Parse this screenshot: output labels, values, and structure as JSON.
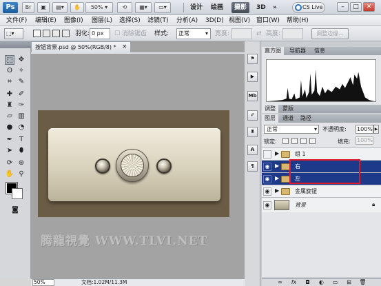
{
  "app": {
    "logo": "Ps",
    "zoom_value": "50%",
    "workspaces": [
      "设计",
      "绘画",
      "摄影",
      "3D"
    ],
    "more_label": "»",
    "cs_live": "CS Live",
    "window_controls": [
      "–",
      "□",
      "✕"
    ]
  },
  "menu": [
    "文件(F)",
    "编辑(E)",
    "图像(I)",
    "图层(L)",
    "选择(S)",
    "滤镜(T)",
    "分析(A)",
    "3D(D)",
    "视图(V)",
    "窗口(W)",
    "帮助(H)"
  ],
  "options": {
    "feather_label": "羽化:",
    "feather_value": "0 px",
    "antialias_label": "消除锯齿",
    "style_label": "样式:",
    "style_value": "正常",
    "width_label": "宽度:",
    "height_label": "高度:",
    "refine_label": "调整边缘..."
  },
  "document": {
    "tab_title": "按钮背景.psd @ 50%(RGB/8) *",
    "close_glyph": "×",
    "watermark": "腾龍視覺 WWW.TLVI.NET"
  },
  "status": {
    "zoom": "50%",
    "doc_info": "文档:1.02M/11.3M"
  },
  "panels": {
    "histogram_tabs": [
      "直方图",
      "导航器",
      "信息"
    ],
    "adjust_tabs": [
      "调整",
      "蒙版"
    ],
    "layers_tabs": [
      "图层",
      "通道",
      "路径"
    ],
    "blend_mode": "正常",
    "opacity_label": "不透明度:",
    "opacity_value": "100%",
    "lock_label": "锁定:",
    "fill_label": "填充:",
    "fill_value": "100%",
    "layers": [
      {
        "name": "组 1",
        "type": "group",
        "visible": false,
        "selected": false
      },
      {
        "name": "右",
        "type": "group",
        "visible": true,
        "selected": true
      },
      {
        "name": "左",
        "type": "group",
        "visible": true,
        "selected": true
      },
      {
        "name": "金属旋钮",
        "type": "group",
        "visible": true,
        "selected": false
      },
      {
        "name": "背景",
        "type": "image",
        "visible": true,
        "selected": false
      }
    ],
    "footer_icons": [
      "link-icon",
      "fx-icon",
      "mask-icon",
      "adjustment-icon",
      "folder-icon",
      "new-layer-icon",
      "trash-icon"
    ]
  },
  "colors": {
    "selection_blue": "#1d3a8a",
    "highlight_red": "#e0192d",
    "canvas_brown": "#6b5d45"
  }
}
